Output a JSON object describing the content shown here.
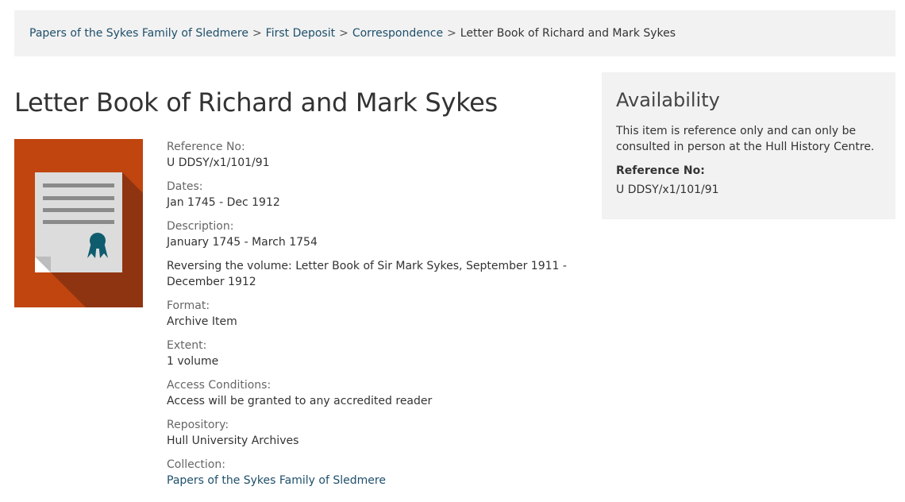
{
  "breadcrumb": {
    "items": [
      {
        "label": "Papers of the Sykes Family of Sledmere",
        "link": true
      },
      {
        "label": "First Deposit",
        "link": true
      },
      {
        "label": "Correspondence",
        "link": true
      },
      {
        "label": "Letter Book of Richard and Mark Sykes",
        "link": false
      }
    ],
    "separator": ">"
  },
  "page": {
    "title": "Letter Book of Richard and Mark Sykes"
  },
  "thumbnail": {
    "icon": "certificate-icon",
    "bg_color": "#c0450f",
    "accent_color": "#0f5c6e"
  },
  "details": {
    "reference": {
      "label": "Reference No:",
      "value": "U DDSY/x1/101/91"
    },
    "dates": {
      "label": "Dates:",
      "value": "Jan 1745 - Dec 1912"
    },
    "description": {
      "label": "Description:",
      "values": [
        "January 1745 - March 1754",
        "Reversing the volume: Letter Book of Sir Mark Sykes, September 1911 - December 1912"
      ]
    },
    "format": {
      "label": "Format:",
      "value": "Archive Item"
    },
    "extent": {
      "label": "Extent:",
      "value": "1 volume"
    },
    "access": {
      "label": "Access Conditions:",
      "value": "Access will be granted to any accredited reader"
    },
    "repository": {
      "label": "Repository:",
      "value": "Hull University Archives"
    },
    "collection": {
      "label": "Collection:",
      "value": "Papers of the Sykes Family of Sledmere"
    }
  },
  "availability": {
    "title": "Availability",
    "text": "This item is reference only and can only be consulted in person at the Hull History Centre.",
    "ref_label": "Reference No:",
    "ref_value": "U DDSY/x1/101/91"
  }
}
